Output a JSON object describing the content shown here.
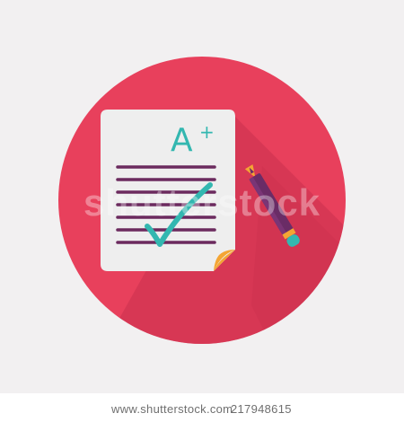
{
  "icon": {
    "name": "graded-test-paper-icon",
    "grade": "A",
    "grade_modifier": "+",
    "colors": {
      "circle": "#e8405c",
      "shadow": "#c9304e",
      "paper": "#eeeeee",
      "paper_fold": "#f4a534",
      "lines": "#6b2a5e",
      "check": "#33b7b0",
      "pencil_body": "#6a2c66",
      "pencil_tip": "#f4a534",
      "pencil_eraser": "#33b7b0"
    }
  },
  "watermark": {
    "text": "shutterstock"
  },
  "footer": {
    "site": "www.shutterstock.com",
    "id": "217948615"
  }
}
